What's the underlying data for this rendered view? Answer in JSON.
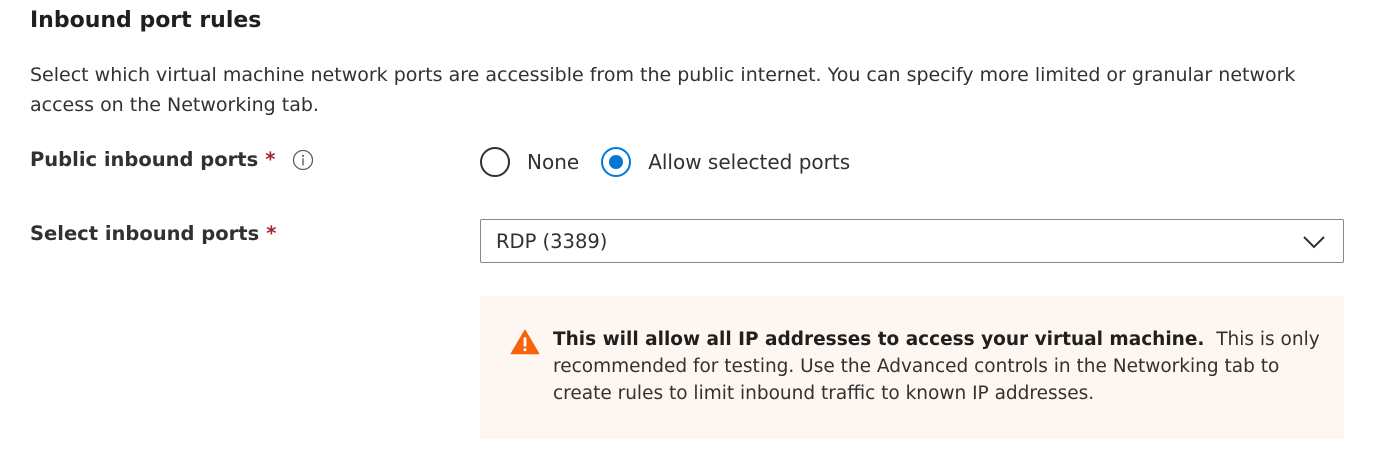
{
  "section": {
    "title": "Inbound port rules",
    "description": "Select which virtual machine network ports are accessible from the public internet. You can specify more limited or granular network access on the Networking tab."
  },
  "public_inbound_ports": {
    "label": "Public inbound ports",
    "required_marker": "*",
    "info_icon": "info-icon",
    "options": [
      {
        "label": "None",
        "selected": false
      },
      {
        "label": "Allow selected ports",
        "selected": true
      }
    ]
  },
  "select_inbound_ports": {
    "label": "Select inbound ports",
    "required_marker": "*",
    "value": "RDP (3389)",
    "icon": "chevron-down-icon"
  },
  "warning": {
    "icon": "warning-icon",
    "bold_text": "This will allow all IP addresses to access your virtual machine.",
    "text": "This is only recommended for testing.  Use the Advanced controls in the Networking tab to create rules to limit inbound traffic to known IP addresses."
  },
  "colors": {
    "accent": "#0078d4",
    "required": "#a4262c",
    "warning_icon": "#f7630c",
    "warning_background": "#fdf6f1",
    "text": "#323130"
  }
}
